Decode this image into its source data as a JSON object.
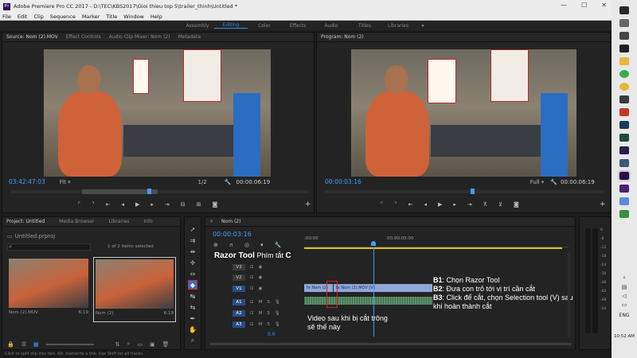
{
  "window": {
    "title": "Adobe Premiere Pro CC 2017 - D:\\TEC\\KBS2017\\Gioi thieu top 5\\trailer_thinh\\Untitled *",
    "app_badge": "Pr"
  },
  "menu": [
    "File",
    "Edit",
    "Clip",
    "Sequence",
    "Marker",
    "Title",
    "Window",
    "Help"
  ],
  "workspaces": {
    "items": [
      "Assembly",
      "Editing",
      "Color",
      "Effects",
      "Audio",
      "Titles",
      "Libraries"
    ],
    "active": "Editing",
    "more": "»"
  },
  "source_panel": {
    "tabs": [
      "Source: Nom (2).MOV",
      "Effect Controls",
      "Audio Clip Mixer: Nom (2)",
      "Metadata"
    ],
    "timecode": "03:42:47:03",
    "fit": "Fit",
    "ratio": "1/2",
    "duration": "00:00:06:19"
  },
  "program_panel": {
    "tabs": [
      "Program: Nom (2)"
    ],
    "timecode": "00:00:03:16",
    "fit": "Full",
    "duration": "00:00:06:19"
  },
  "project_panel": {
    "tabs": [
      "Project: Untitled",
      "Media Browser",
      "Libraries",
      "Info"
    ],
    "file": "Untitled.prproj",
    "selected_info": "1 of 2 items selected",
    "items": [
      {
        "name": "Nom (2).MOV",
        "duration": "6:19"
      },
      {
        "name": "Nom (2)",
        "duration": "6:19"
      }
    ]
  },
  "timeline": {
    "tab": "Nom (2)",
    "timecode": "00:00:03:16",
    "ruler": [
      ":00:00",
      "00:00:05:00"
    ],
    "video_tracks": [
      "V3",
      "V2",
      "V1"
    ],
    "audio_tracks": [
      "A1",
      "A2",
      "A3"
    ],
    "mix_value": "0.0",
    "clip_label_1": "Nom (2)",
    "clip_label_2": "Nom (2).MOV [V]",
    "meter_ticks": [
      "0",
      "-6",
      "-12",
      "-18",
      "-24",
      "-30",
      "-36",
      "-42",
      "-48",
      "-54"
    ]
  },
  "annotations": {
    "razor": "Razor Tool",
    "shortcut_prefix": " Phím tắt ",
    "shortcut_key": "C",
    "b1_key": "B1",
    "b1": ": Chọn Razor Tool",
    "b2_key": "B2",
    "b2": ": Đưa con trỏ tới vị trí cần cắt",
    "b3_key": "B3",
    "b3": ": Click để cắt, chọn Selection tool (V)  sau khi hoàn thành cắt",
    "video_after": "Video sau khi bị cắt trông sẽ thế này"
  },
  "status_bar": "Click to split clip into two. Alt: overwrite a link. Use Shift for all tracks.",
  "taskbar": {
    "lang": "ENG",
    "time": "10:52 AM"
  },
  "colors": {
    "accent": "#2e8ae6",
    "timecode": "#3f9bff",
    "clip": "#8fa7d8",
    "selection": "#e02020"
  }
}
